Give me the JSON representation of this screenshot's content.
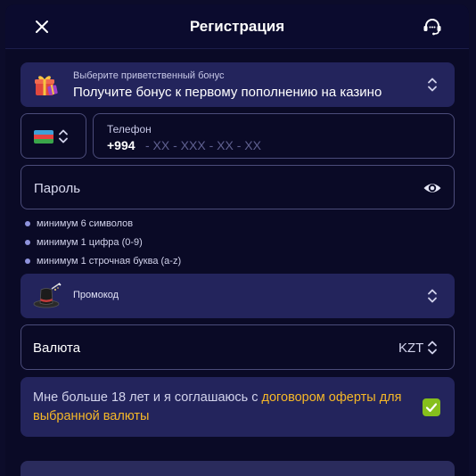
{
  "header": {
    "title": "Регистрация",
    "close_icon": "close-icon",
    "support_icon": "headset-icon"
  },
  "bonus": {
    "caption": "Выберите приветственный бонус",
    "value": "Получите бонус к первому пополнению на казино",
    "icon": "gift-icon"
  },
  "phone": {
    "country_flag": "azerbaijan-flag-icon",
    "label": "Телефон",
    "code": "+994",
    "mask": "- XX - XXX - XX - XX"
  },
  "password": {
    "placeholder": "Пароль",
    "icon": "eye-icon"
  },
  "password_rules": [
    "минимум 6 символов",
    "минимум 1 цифра (0-9)",
    "минимум 1 строчная буква (a-z)"
  ],
  "promo": {
    "label": "Промокод",
    "icon": "magic-hat-icon"
  },
  "currency": {
    "label": "Валюта",
    "value": "KZT"
  },
  "agreement": {
    "text_before": "Мне больше 18 лет и я соглашаюсь с ",
    "link_text": "договором оферты для выбранной валюты",
    "checked": true
  },
  "colors": {
    "background": "#0a0a26",
    "panel": "#23245c",
    "accent_link": "#f6b828",
    "checkbox": "#86bf1c"
  }
}
